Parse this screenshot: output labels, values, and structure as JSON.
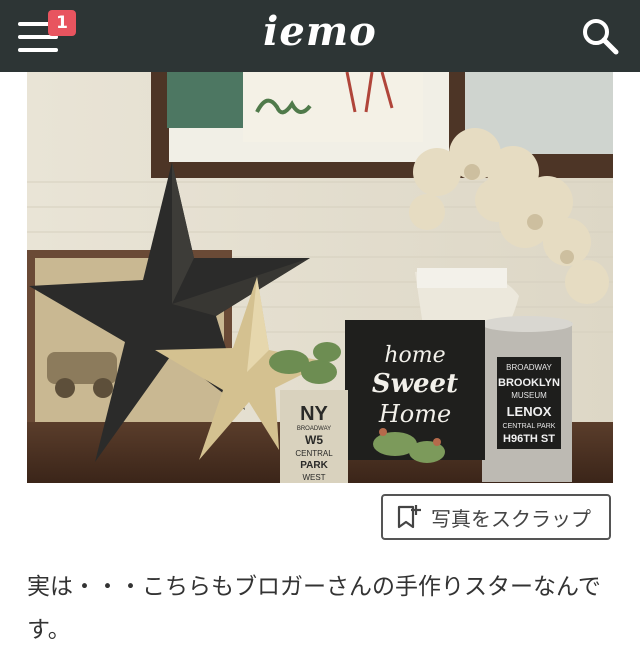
{
  "header": {
    "logo": "iemo",
    "notification_count": "1",
    "menu_icon": "hamburger-menu-icon",
    "search_icon": "search-icon",
    "background": "#2d3535",
    "badge_color": "#e8545f"
  },
  "photo": {
    "sign_text": [
      "home",
      "Sweet",
      "Home"
    ],
    "cup_text": [
      "BROADWAY",
      "BROOKLYN",
      "MUSEUM",
      "LENOX",
      "CENTRAL PARK",
      "H96TH ST"
    ],
    "can_text": [
      "NY",
      "BROADWAY",
      "W5",
      "CENTRAL",
      "PARK",
      "WEST"
    ]
  },
  "scrap_button": {
    "label": "写真をスクラップ",
    "icon": "bookmark-plus-icon"
  },
  "caption": "実は・・・こちらもブロガーさんの手作りスターなんです。"
}
